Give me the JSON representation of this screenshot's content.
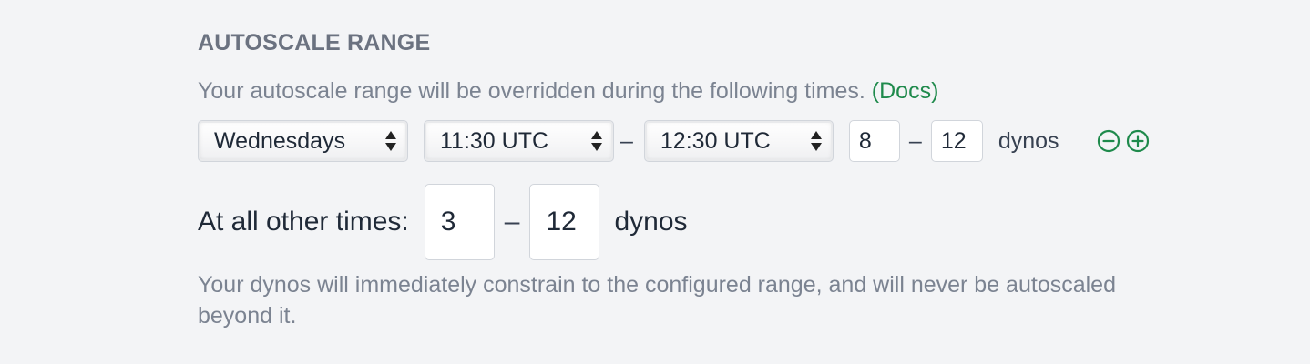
{
  "section": {
    "heading": "AUTOSCALE RANGE",
    "description": "Your autoscale range will be overridden during the following times.",
    "docs_link": "(Docs)",
    "accent_color": "#1f8a4c"
  },
  "schedule_row": {
    "day_select": "Wednesdays",
    "start_time_select": "11:30 UTC",
    "range_separator": "–",
    "end_time_select": "12:30 UTC",
    "min_dynos": "8",
    "dynos_separator": "–",
    "max_dynos": "12",
    "unit_label": "dynos",
    "remove_icon": "minus-circle-icon",
    "add_icon": "plus-circle-icon"
  },
  "default_range": {
    "label": "At all other times:",
    "min_dynos": "3",
    "separator": "–",
    "max_dynos": "12",
    "unit_label": "dynos"
  },
  "footer_note": "Your dynos will immediately constrain to the configured range, and will never be autoscaled beyond it."
}
